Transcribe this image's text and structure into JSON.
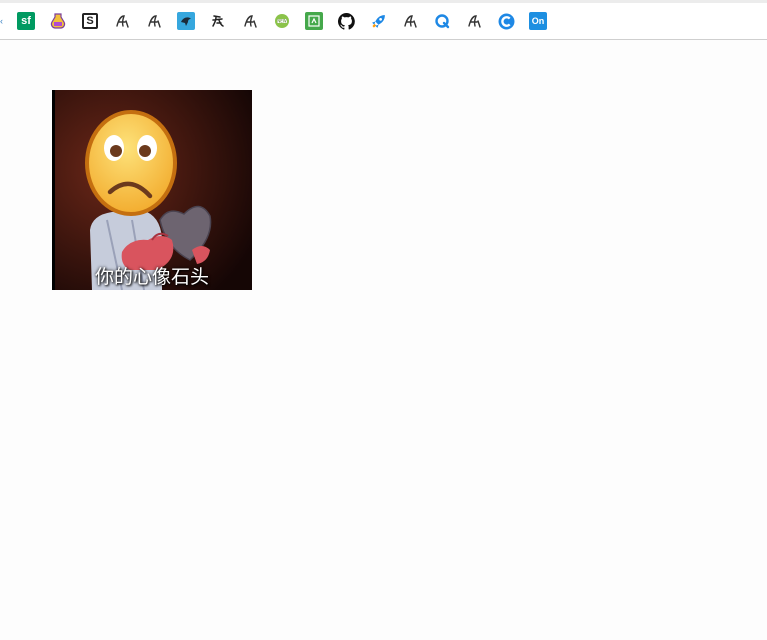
{
  "bookmarks": {
    "items": [
      {
        "name": "sf-icon",
        "label": "sf"
      },
      {
        "name": "potion-icon"
      },
      {
        "name": "s-icon",
        "label": "S"
      },
      {
        "name": "script-a-icon"
      },
      {
        "name": "script-a-icon"
      },
      {
        "name": "blue-bird-icon"
      },
      {
        "name": "calligraphy-icon"
      },
      {
        "name": "script-a-icon"
      },
      {
        "name": "green-badge-icon"
      },
      {
        "name": "green-square-icon"
      },
      {
        "name": "github-icon"
      },
      {
        "name": "rocket-icon"
      },
      {
        "name": "script-a-icon"
      },
      {
        "name": "q-circle-icon"
      },
      {
        "name": "script-a-icon"
      },
      {
        "name": "c-circle-icon"
      },
      {
        "name": "on-icon",
        "label": "On"
      }
    ]
  },
  "content": {
    "meme_caption": "你的心像石头"
  },
  "colors": {
    "bar_border": "#cfcfcf",
    "page_bg": "#fdfdfd",
    "emoji_yellow": "#f9c93a"
  }
}
